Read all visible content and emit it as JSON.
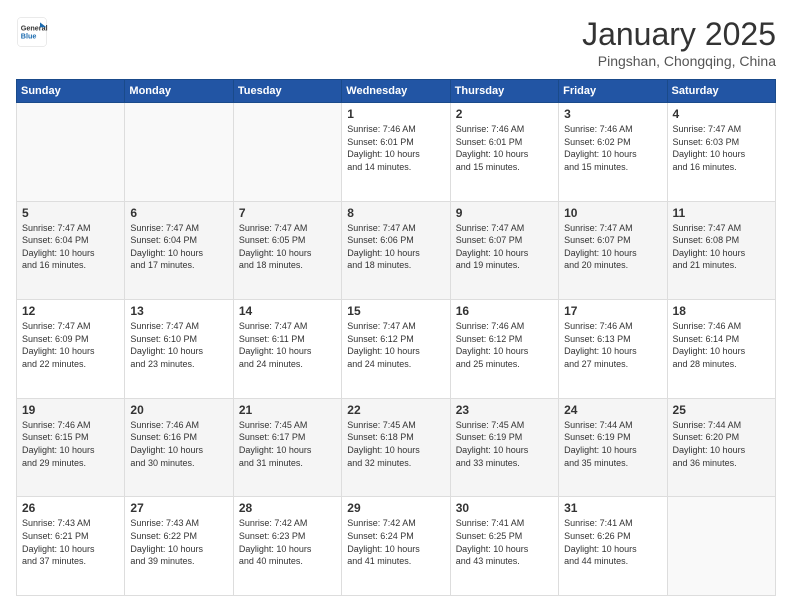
{
  "header": {
    "logo_general": "General",
    "logo_blue": "Blue",
    "month_title": "January 2025",
    "subtitle": "Pingshan, Chongqing, China"
  },
  "weekdays": [
    "Sunday",
    "Monday",
    "Tuesday",
    "Wednesday",
    "Thursday",
    "Friday",
    "Saturday"
  ],
  "weeks": [
    [
      {
        "day": "",
        "info": ""
      },
      {
        "day": "",
        "info": ""
      },
      {
        "day": "",
        "info": ""
      },
      {
        "day": "1",
        "info": "Sunrise: 7:46 AM\nSunset: 6:01 PM\nDaylight: 10 hours\nand 14 minutes."
      },
      {
        "day": "2",
        "info": "Sunrise: 7:46 AM\nSunset: 6:01 PM\nDaylight: 10 hours\nand 15 minutes."
      },
      {
        "day": "3",
        "info": "Sunrise: 7:46 AM\nSunset: 6:02 PM\nDaylight: 10 hours\nand 15 minutes."
      },
      {
        "day": "4",
        "info": "Sunrise: 7:47 AM\nSunset: 6:03 PM\nDaylight: 10 hours\nand 16 minutes."
      }
    ],
    [
      {
        "day": "5",
        "info": "Sunrise: 7:47 AM\nSunset: 6:04 PM\nDaylight: 10 hours\nand 16 minutes."
      },
      {
        "day": "6",
        "info": "Sunrise: 7:47 AM\nSunset: 6:04 PM\nDaylight: 10 hours\nand 17 minutes."
      },
      {
        "day": "7",
        "info": "Sunrise: 7:47 AM\nSunset: 6:05 PM\nDaylight: 10 hours\nand 18 minutes."
      },
      {
        "day": "8",
        "info": "Sunrise: 7:47 AM\nSunset: 6:06 PM\nDaylight: 10 hours\nand 18 minutes."
      },
      {
        "day": "9",
        "info": "Sunrise: 7:47 AM\nSunset: 6:07 PM\nDaylight: 10 hours\nand 19 minutes."
      },
      {
        "day": "10",
        "info": "Sunrise: 7:47 AM\nSunset: 6:07 PM\nDaylight: 10 hours\nand 20 minutes."
      },
      {
        "day": "11",
        "info": "Sunrise: 7:47 AM\nSunset: 6:08 PM\nDaylight: 10 hours\nand 21 minutes."
      }
    ],
    [
      {
        "day": "12",
        "info": "Sunrise: 7:47 AM\nSunset: 6:09 PM\nDaylight: 10 hours\nand 22 minutes."
      },
      {
        "day": "13",
        "info": "Sunrise: 7:47 AM\nSunset: 6:10 PM\nDaylight: 10 hours\nand 23 minutes."
      },
      {
        "day": "14",
        "info": "Sunrise: 7:47 AM\nSunset: 6:11 PM\nDaylight: 10 hours\nand 24 minutes."
      },
      {
        "day": "15",
        "info": "Sunrise: 7:47 AM\nSunset: 6:12 PM\nDaylight: 10 hours\nand 24 minutes."
      },
      {
        "day": "16",
        "info": "Sunrise: 7:46 AM\nSunset: 6:12 PM\nDaylight: 10 hours\nand 25 minutes."
      },
      {
        "day": "17",
        "info": "Sunrise: 7:46 AM\nSunset: 6:13 PM\nDaylight: 10 hours\nand 27 minutes."
      },
      {
        "day": "18",
        "info": "Sunrise: 7:46 AM\nSunset: 6:14 PM\nDaylight: 10 hours\nand 28 minutes."
      }
    ],
    [
      {
        "day": "19",
        "info": "Sunrise: 7:46 AM\nSunset: 6:15 PM\nDaylight: 10 hours\nand 29 minutes."
      },
      {
        "day": "20",
        "info": "Sunrise: 7:46 AM\nSunset: 6:16 PM\nDaylight: 10 hours\nand 30 minutes."
      },
      {
        "day": "21",
        "info": "Sunrise: 7:45 AM\nSunset: 6:17 PM\nDaylight: 10 hours\nand 31 minutes."
      },
      {
        "day": "22",
        "info": "Sunrise: 7:45 AM\nSunset: 6:18 PM\nDaylight: 10 hours\nand 32 minutes."
      },
      {
        "day": "23",
        "info": "Sunrise: 7:45 AM\nSunset: 6:19 PM\nDaylight: 10 hours\nand 33 minutes."
      },
      {
        "day": "24",
        "info": "Sunrise: 7:44 AM\nSunset: 6:19 PM\nDaylight: 10 hours\nand 35 minutes."
      },
      {
        "day": "25",
        "info": "Sunrise: 7:44 AM\nSunset: 6:20 PM\nDaylight: 10 hours\nand 36 minutes."
      }
    ],
    [
      {
        "day": "26",
        "info": "Sunrise: 7:43 AM\nSunset: 6:21 PM\nDaylight: 10 hours\nand 37 minutes."
      },
      {
        "day": "27",
        "info": "Sunrise: 7:43 AM\nSunset: 6:22 PM\nDaylight: 10 hours\nand 39 minutes."
      },
      {
        "day": "28",
        "info": "Sunrise: 7:42 AM\nSunset: 6:23 PM\nDaylight: 10 hours\nand 40 minutes."
      },
      {
        "day": "29",
        "info": "Sunrise: 7:42 AM\nSunset: 6:24 PM\nDaylight: 10 hours\nand 41 minutes."
      },
      {
        "day": "30",
        "info": "Sunrise: 7:41 AM\nSunset: 6:25 PM\nDaylight: 10 hours\nand 43 minutes."
      },
      {
        "day": "31",
        "info": "Sunrise: 7:41 AM\nSunset: 6:26 PM\nDaylight: 10 hours\nand 44 minutes."
      },
      {
        "day": "",
        "info": ""
      }
    ]
  ]
}
